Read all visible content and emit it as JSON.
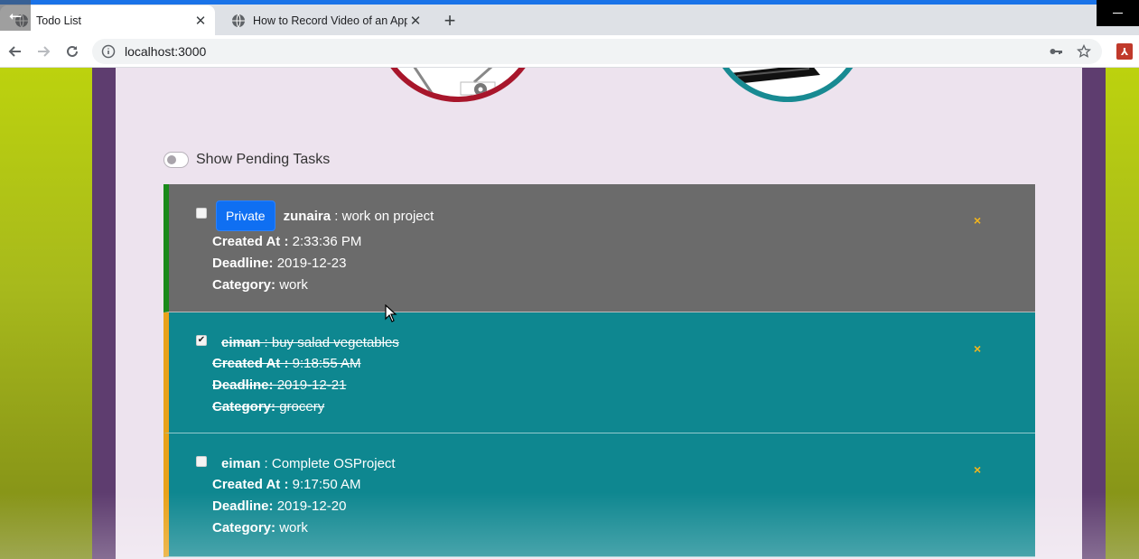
{
  "browser": {
    "tabs": [
      {
        "title": "Todo List",
        "active": true
      },
      {
        "title": "How to Record Video of an App",
        "active": false
      }
    ],
    "url": "localhost:3000"
  },
  "filter": {
    "label": "Show Pending Tasks",
    "enabled": false
  },
  "todos": [
    {
      "user": "zunaira",
      "separator": " : ",
      "text": "work on project",
      "badge": "Private",
      "created_label": "Created At :",
      "created_value": "2:33:36 PM",
      "deadline_label": "Deadline:",
      "deadline_value": "2019-12-23",
      "category_label": "Category:",
      "category_value": "work",
      "completed": false,
      "delete_glyph": "×"
    },
    {
      "user": "eiman",
      "separator": " : ",
      "text": "buy salad vegetables",
      "created_label": "Created At :",
      "created_value": "9:18:55 AM",
      "deadline_label": "Deadline:",
      "deadline_value": "2019-12-21",
      "category_label": "Category:",
      "category_value": "grocery",
      "completed": true,
      "delete_glyph": "×"
    },
    {
      "user": "eiman",
      "separator": " : ",
      "text": "Complete OSProject",
      "created_label": "Created At :",
      "created_value": "9:17:50 AM",
      "deadline_label": "Deadline:",
      "deadline_value": "2019-12-20",
      "category_label": "Category:",
      "category_value": "work",
      "completed": false,
      "delete_glyph": "×"
    }
  ],
  "colors": {
    "private_row": "#6b6b6b",
    "public_row": "#0e8790",
    "private_accent": "#1a8a1a",
    "public_accent": "#e8a21a",
    "delete": "#f3b61c",
    "badge": "#0f6ff2"
  },
  "icons": {
    "tab_favicon": "globe-icon",
    "back": "back-arrow-icon",
    "forward": "forward-arrow-icon",
    "reload": "reload-icon",
    "site_info": "info-icon",
    "password": "key-icon",
    "bookmark": "star-icon",
    "extension": "pdf-extension-icon"
  }
}
